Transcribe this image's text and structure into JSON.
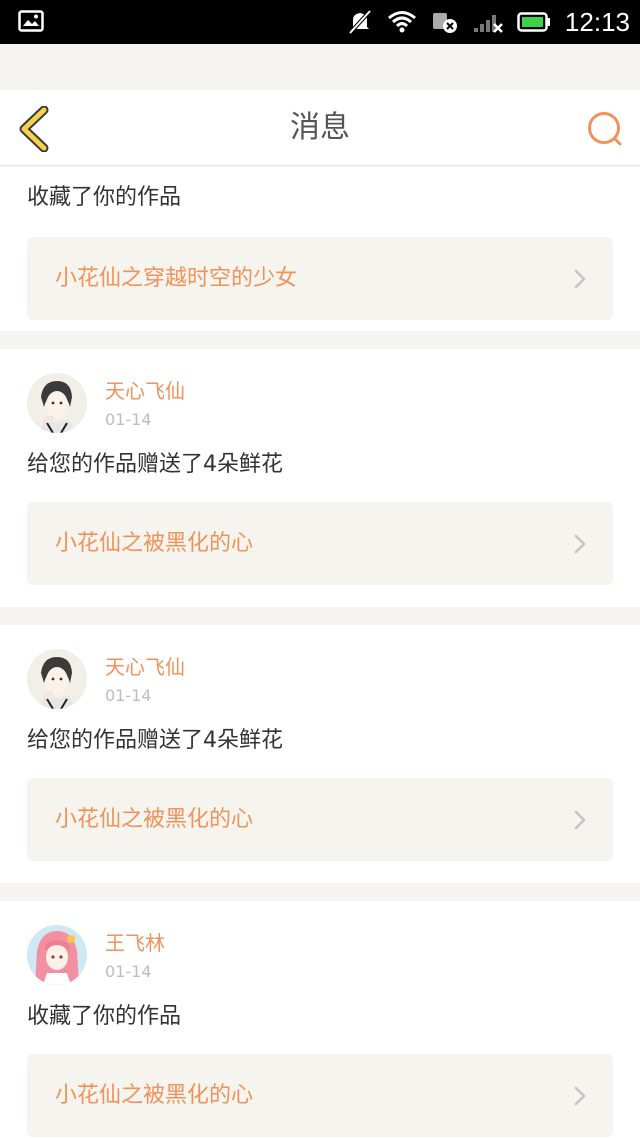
{
  "status_bar": {
    "time": "12:13",
    "icons": [
      "image-notification-icon",
      "mute-icon",
      "wifi-icon",
      "data-disabled-icon",
      "signal-icon",
      "battery-icon"
    ]
  },
  "nav": {
    "title": "消息",
    "back_icon": "chevron-left-icon",
    "search_icon": "search-icon"
  },
  "messages": [
    {
      "action": "收藏了你的作品",
      "work_title": "小花仙之穿越时空的少女"
    },
    {
      "user": "天心飞仙",
      "date": "01-14",
      "action": "给您的作品赠送了4朵鲜花",
      "work_title": "小花仙之被黑化的心"
    },
    {
      "user": "天心飞仙",
      "date": "01-14",
      "action": "给您的作品赠送了4朵鲜花",
      "work_title": "小花仙之被黑化的心"
    },
    {
      "user": "王飞林",
      "date": "01-14",
      "action": "收藏了你的作品",
      "work_title": "小花仙之被黑化的心"
    }
  ],
  "colors": {
    "accent": "#f0925a",
    "back_icon": "#f5d24a",
    "card_bg": "#f5f4ee"
  }
}
